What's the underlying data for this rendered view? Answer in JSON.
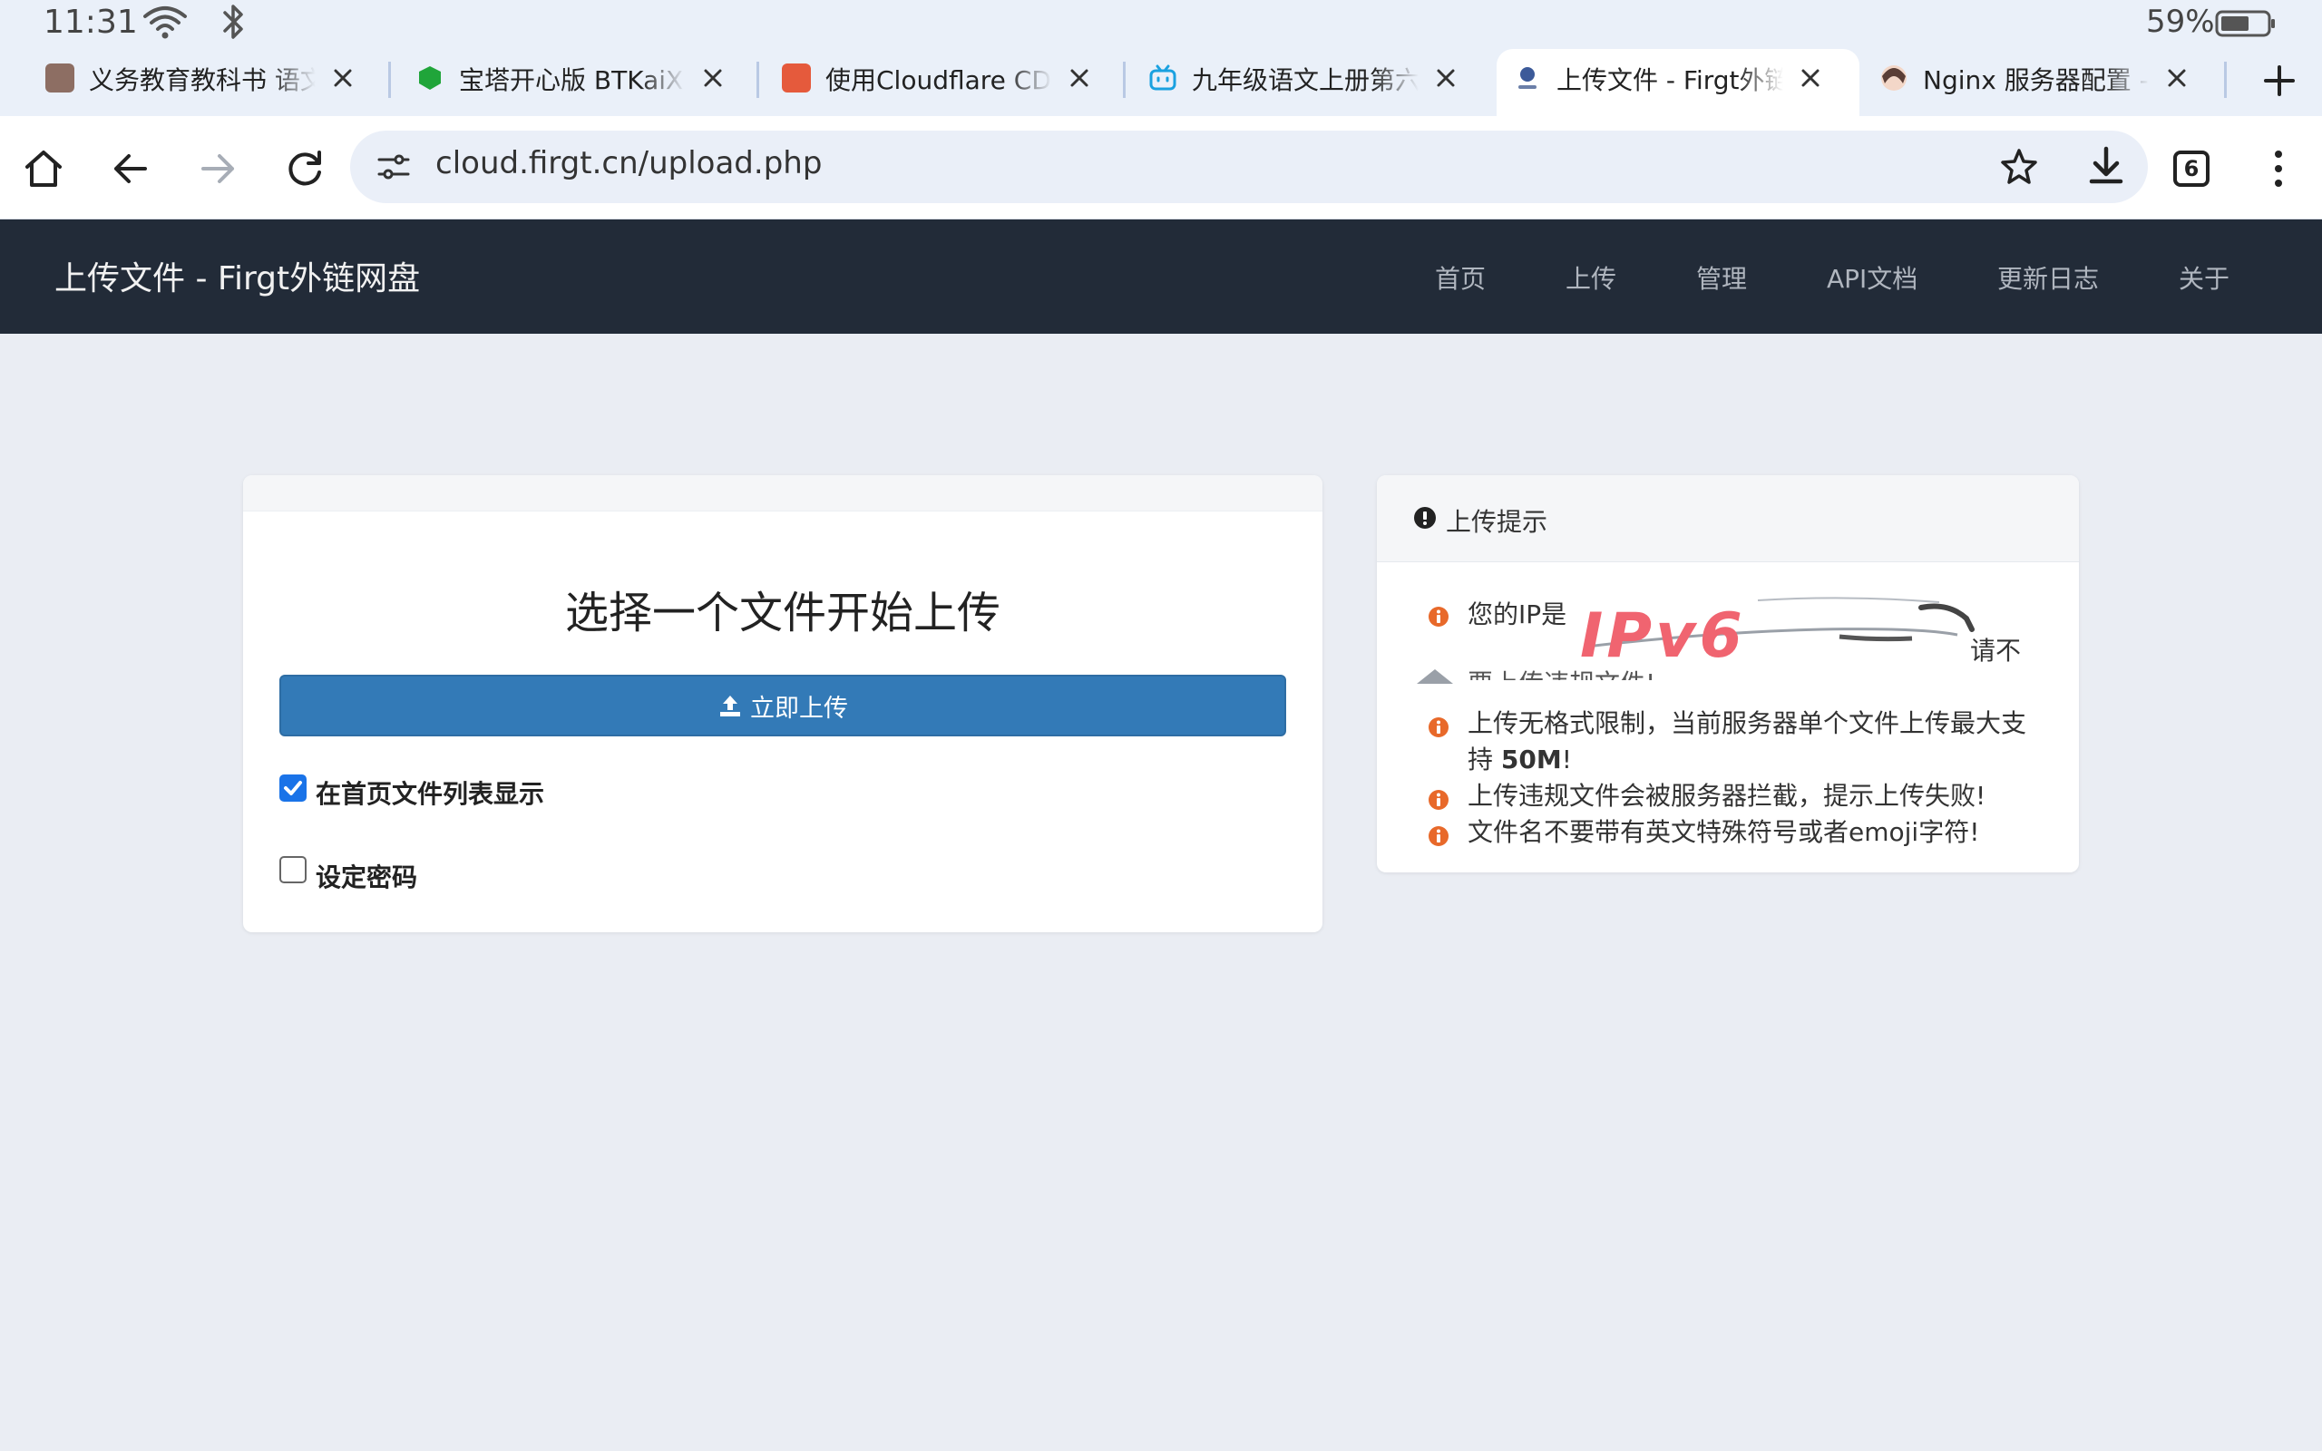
{
  "status_bar": {
    "time": "11:31",
    "battery": "59%"
  },
  "tabs": [
    {
      "title": "义务教育教科书 语文 九",
      "favicon_color": "#8d6e63"
    },
    {
      "title": "宝塔开心版 BTKaiXin.cn",
      "favicon_color": "#20a53a"
    },
    {
      "title": "使用Cloudflare CDN后",
      "favicon_color": "#e55a3c"
    },
    {
      "title": "九年级语文上册第六课",
      "favicon_color": "#1aa1e0"
    },
    {
      "title": "上传文件 - Firgt外链网盘",
      "favicon_color": "#3c5a99"
    },
    {
      "title": "Nginx 服务器配置 - 豆包",
      "favicon_color": "#d9a58a"
    }
  ],
  "toolbar": {
    "url": "cloud.firgt.cn/upload.php",
    "tab_count": "6"
  },
  "site": {
    "brand": "上传文件 - Firgt外链网盘",
    "nav": [
      "首页",
      "上传",
      "管理",
      "API文档",
      "更新日志",
      "关于"
    ]
  },
  "upload": {
    "heading": "选择一个文件开始上传",
    "button_label": "立即上传",
    "show_on_home_label": "在首页文件列表显示",
    "show_on_home_checked": true,
    "set_password_label": "设定密码",
    "set_password_checked": false
  },
  "tips": {
    "title": "上传提示",
    "ip_prefix": "您的IP是",
    "ip_handwritten": "IPv6",
    "ip_suffix": "请不",
    "ip_line2": "要上传违规文件!",
    "size_limit_text": "上传无格式限制，当前服务器单个文件上传最大支持",
    "size_limit_value": "50M",
    "size_limit_end": "!",
    "violation_text": "上传违规文件会被服务器拦截，提示上传失败!",
    "filename_text": "文件名不要带有英文特殊符号或者emoji字符!"
  },
  "colors": {
    "navbar_bg": "#222b38",
    "primary_button": "#337ab7",
    "tip_icon": "#e8692a",
    "scribble": "#f06470"
  }
}
